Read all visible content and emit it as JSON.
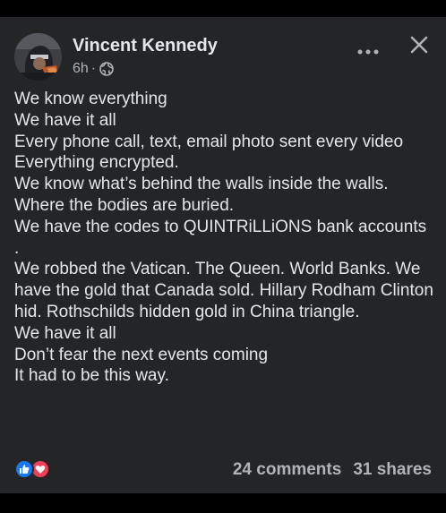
{
  "post": {
    "author": "Vincent Kennedy",
    "time": "6h",
    "separator": "·",
    "privacy_icon": "globe-icon",
    "more_icon": "more-options-icon",
    "close_icon": "close-icon",
    "text": "We know everything\nWe have it all\nEvery phone call, text, email photo sent every video\nEverything encrypted.\nWe know what’s behind the walls inside the walls.\nWhere the bodies are buried.\nWe have the codes to QUINTRiLLiONS bank accounts .\nWe robbed the Vatican. The Queen. World Banks. We have the gold that Canada sold. Hillary Rodham Clinton hid. Rothschilds hidden gold in China triangle.\nWe have it all\nDon’t fear the next events coming\nIt had to be this way."
  },
  "footer": {
    "reactions": [
      "like-icon",
      "love-icon"
    ],
    "comments": "24 comments",
    "shares": "31 shares"
  },
  "colors": {
    "background": "#000000",
    "card": "#242526",
    "primary_text": "#e4e6eb",
    "secondary_text": "#b0b3b8",
    "like_blue": "#1877f2",
    "love_red": "#f33e58"
  }
}
